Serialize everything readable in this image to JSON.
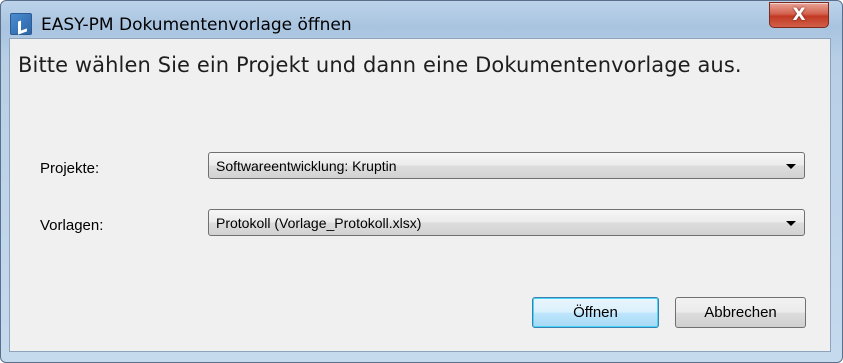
{
  "window": {
    "title": "EASY-PM Dokumentenvorlage öffnen",
    "close_label": "X"
  },
  "instruction": "Bitte wählen Sie ein Projekt und dann eine Dokumentenvorlage aus.",
  "projects": {
    "label": "Projekte:",
    "selected": "Softwareentwicklung: Kruptin"
  },
  "templates": {
    "label": "Vorlagen:",
    "selected": "Protokoll (Vorlage_Protokoll.xlsx)"
  },
  "buttons": {
    "open": "Öffnen",
    "cancel": "Abbrechen"
  },
  "colors": {
    "title_bar": "#a9c4e0",
    "close_button": "#c23a24",
    "client_bg": "#f0f0f0",
    "default_button_border": "#3c7fb1"
  }
}
